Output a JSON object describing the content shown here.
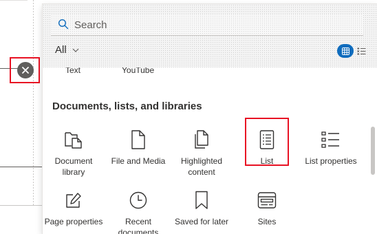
{
  "close_button": {
    "icon": "close-icon",
    "color": "#605e5c"
  },
  "search": {
    "placeholder": "Search",
    "value": ""
  },
  "filter": {
    "label": "All",
    "icon": "chevron-down-icon"
  },
  "view_toggle": {
    "active": "grid",
    "accent": "#0f6cbd"
  },
  "partial_row": {
    "items": [
      "Text",
      "YouTube"
    ]
  },
  "section": {
    "title": "Documents, lists, and libraries",
    "tiles": [
      {
        "label": "Document library",
        "icon": "document-library-icon"
      },
      {
        "label": "File and Media",
        "icon": "file-icon"
      },
      {
        "label": "Highlighted content",
        "icon": "highlighted-content-icon"
      },
      {
        "label": "List",
        "icon": "list-icon"
      },
      {
        "label": "List properties",
        "icon": "list-properties-icon"
      },
      {
        "label": "Page properties",
        "icon": "page-properties-icon"
      },
      {
        "label": "Recent documents",
        "icon": "clock-icon"
      },
      {
        "label": "Saved for later",
        "icon": "bookmark-icon"
      },
      {
        "label": "Sites",
        "icon": "sites-icon"
      }
    ]
  },
  "highlight_color": "#e81123"
}
